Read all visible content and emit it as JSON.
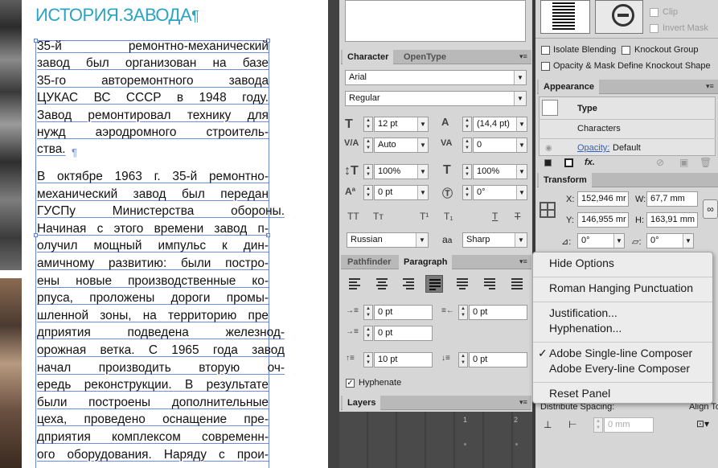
{
  "document": {
    "title": "ИСТОРИЯ.ЗАВОДА",
    "title_pilcrow": "¶",
    "para1": [
      "35-й     ремонтно-механический",
      "завод был организован на базе",
      "35-го   авторемонтного   завода",
      "ЦУКАС ВС СССР в 1948 году.",
      "Завод ремонтировал технику для",
      "нужд   аэродромного   строитель-",
      "ства."
    ],
    "para1_pilcrow": "¶",
    "para2": [
      "В октябре 1963 г. 35-й ремонтно-",
      "механический завод был передан",
      " ГУСПу    Министерства    обороны.",
      " Начиная с этого времени завод п-",
      "олучил   мощный   импульс   к  дин-",
      "амичному развитию: были постро-",
      "ены новые производственные ко-",
      "рпуса, проложены дороги промы-",
      "шленной зоны, на территорию пре",
      "дприятия    подведена    железнод-",
      "орожная ветка. С 1965 года завод",
      " начал   производить   вторую   оч-",
      "ередь реконструкции. В результате",
      " были построены дополнительные",
      " цеха, проведено оснащение пре-",
      "дприятия комплексом современн-",
      "ого оборудования. Наряду с прои-"
    ]
  },
  "character_panel": {
    "tabs": [
      "Character",
      "OpenType"
    ],
    "font_family": "Arial",
    "font_style": "Regular",
    "size": "12 pt",
    "leading": "(14,4 pt)",
    "kerning": "Auto",
    "tracking": "0",
    "vscale": "100%",
    "hscale": "100%",
    "baseline": "0 pt",
    "skew": "0°",
    "language": "Russian",
    "aa_label": "a",
    "antialias": "Sharp",
    "style_buttons": [
      "TT",
      "Tт",
      "T¹",
      "T₁",
      "T",
      "T"
    ]
  },
  "paragraph_panel": {
    "tabs": [
      "Pathfinder",
      "Paragraph"
    ],
    "left_indent": "0 pt",
    "right_indent": "0 pt",
    "first_indent": "0 pt",
    "space_before": "10 pt",
    "space_after": "0 pt",
    "hyphenate_label": "Hyphenate",
    "hyphenate_checked": true
  },
  "layers_panel": {
    "tab": "Layers",
    "ruler_numbers": [
      "1",
      "2"
    ]
  },
  "transparency_panel": {
    "clip_label": "Clip",
    "invert_mask_label": "Invert Mask",
    "isolate_blending": "Isolate Blending",
    "knockout_group": "Knockout Group",
    "opacity_mask_text": "Opacity & Mask Define Knockout Shape"
  },
  "appearance_panel": {
    "tab": "Appearance",
    "type_label": "Type",
    "characters_label": "Characters",
    "opacity_label": "Opacity:",
    "opacity_value": "Default",
    "fx_label": "fx."
  },
  "transform_panel": {
    "tab": "Transform",
    "x_label": "X:",
    "x_value": "152,946 mr",
    "y_label": "Y:",
    "y_value": "146,955 mr",
    "w_label": "W:",
    "w_value": "67,7 mm",
    "h_label": "H:",
    "h_value": "163,91 mm",
    "rotate": "0°",
    "shear": "0°"
  },
  "align_panel": {
    "distribute_spacing": "Distribute Spacing:",
    "align_to": "Align To",
    "spacing_value": "0 mm"
  },
  "flyout_menu": {
    "items": [
      {
        "label": "Hide Options"
      },
      {
        "label": "Roman Hanging Punctuation"
      },
      {
        "label": "Justification..."
      },
      {
        "label": "Hyphenation..."
      },
      {
        "label": "Adobe Single-line Composer",
        "checked": true
      },
      {
        "label": "Adobe Every-line Composer"
      },
      {
        "label": "Reset Panel"
      }
    ],
    "check_glyph": "✓"
  }
}
